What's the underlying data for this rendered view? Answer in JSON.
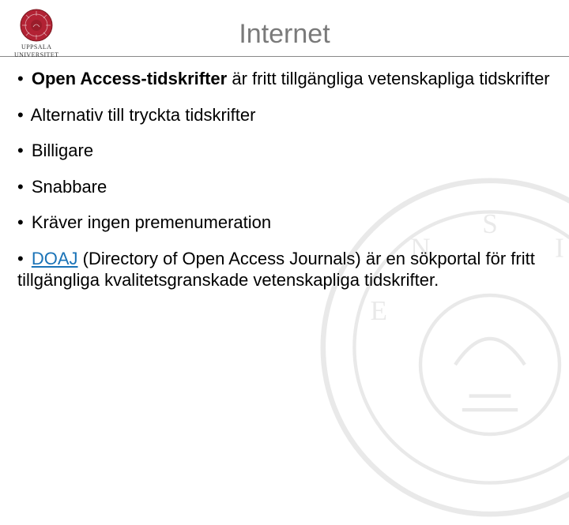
{
  "header": {
    "logo_top": "UPPSALA",
    "logo_bottom": "UNIVERSITET",
    "title": "Internet"
  },
  "bullets": {
    "b1_bold": "Open Access-tidskrifter",
    "b1_rest": " är fritt tillgängliga vetenskapliga tidskrifter",
    "b2": "Alternativ till tryckta tidskrifter",
    "b3": "Billigare",
    "b4": "Snabbare",
    "b5": "Kräver ingen premenumeration",
    "b6_link": "DOAJ",
    "b6_rest": "  (Directory of Open Access Journals) är en sökportal för fritt tillgängliga kvalitetsgranskade vetenskapliga tidskrifter."
  }
}
